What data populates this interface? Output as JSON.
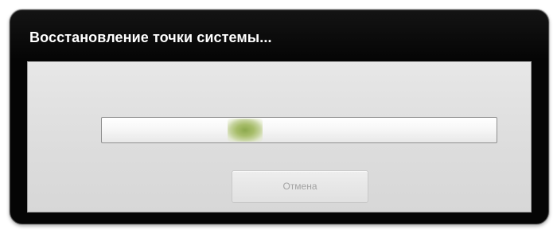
{
  "dialog": {
    "title": "Восстановление точки системы..."
  },
  "progress": {
    "mode": "marquee",
    "indicator_position_fraction": 0.35,
    "indicator_color": "#a7bd6a"
  },
  "buttons": {
    "cancel_label": "Отмена",
    "cancel_enabled": false
  },
  "colors": {
    "frame": "#050505",
    "title_text": "#ffffff",
    "content_bg": "#dedede",
    "disabled_text": "#a3a3a3"
  }
}
